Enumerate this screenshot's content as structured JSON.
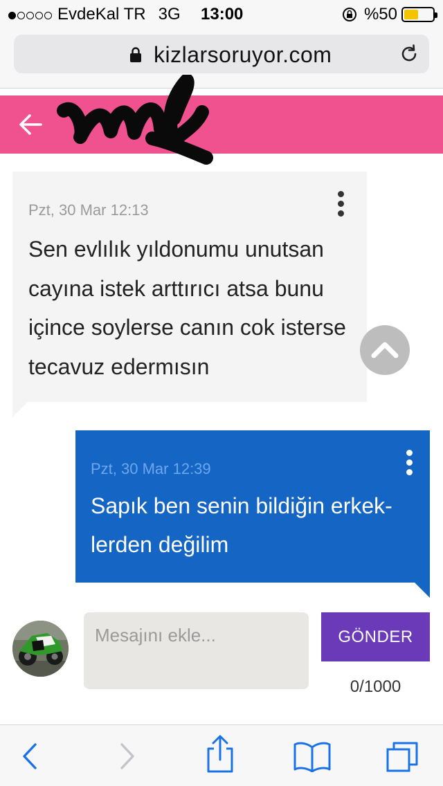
{
  "status_bar": {
    "carrier": "EvdeKal TR",
    "network": "3G",
    "time": "13:00",
    "battery": "%50",
    "battery_level": 0.5,
    "signal_bars_filled": 1,
    "signal_bars_total": 5
  },
  "browser": {
    "url": "kizlarsoruyor.com",
    "icons": [
      "lock-icon",
      "reload-icon"
    ]
  },
  "conversation_header": {
    "title": "",
    "color": "#f0518f",
    "icons": [
      "back-arrow-icon"
    ]
  },
  "messages": [
    {
      "direction": "incoming",
      "timestamp": "Pzt, 30 Mar 12:13",
      "text": "Sen evlılık yıldonumu unutsan cayına istek arttırıcı atsa bunu içince soylerse canın cok isterse tecavuz edermısın",
      "bubble_color": "#f4f4f4"
    },
    {
      "direction": "outgoing",
      "timestamp": "Pzt, 30 Mar 12:39",
      "text": "Sapık ben senin bildiğin erkek-lerden değilim",
      "bubble_color": "#1465c4"
    }
  ],
  "composer": {
    "placeholder": "Mesajını ekle...",
    "value": "",
    "send_label": "GÖNDER",
    "counter": "0/1000",
    "send_color": "#6b3ab8"
  },
  "toolbar": {
    "icons": [
      "back-chevron-icon",
      "forward-chevron-icon",
      "share-icon",
      "bookmarks-icon",
      "tabs-icon"
    ]
  }
}
